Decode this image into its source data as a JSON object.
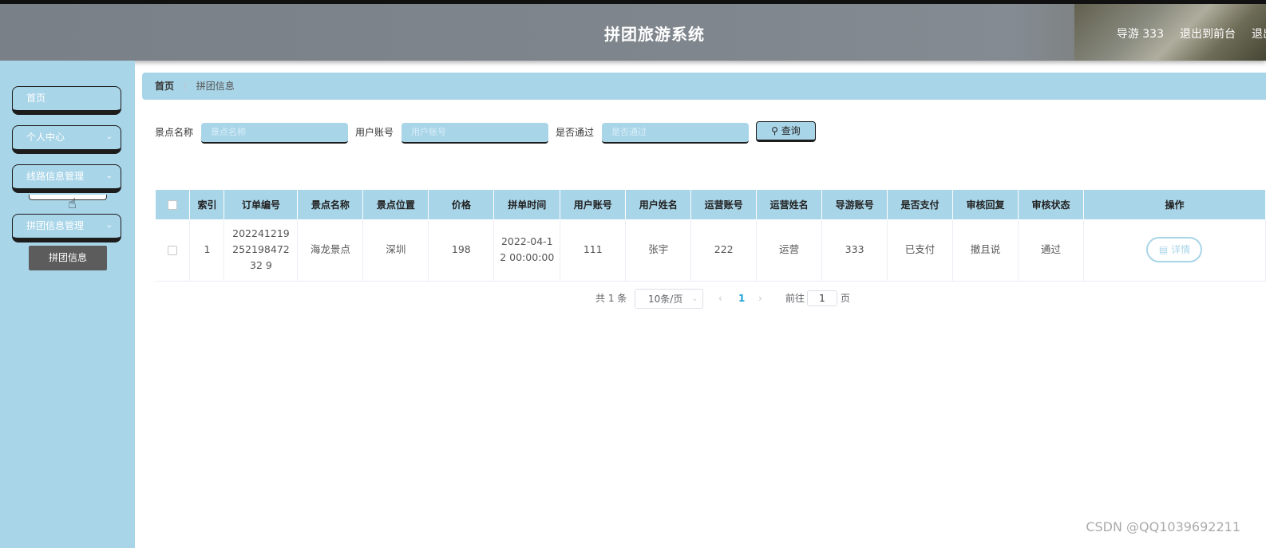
{
  "header": {
    "title": "拼团旅游系统",
    "user": "导游 333",
    "exit_front": "退出到前台",
    "logout": "退出"
  },
  "sidebar": {
    "items": [
      {
        "label": "首页"
      },
      {
        "label": "个人中心"
      },
      {
        "label": "线路信息管理"
      },
      {
        "label": "拼团信息管理"
      }
    ],
    "sub_item": "拼团信息"
  },
  "breadcrumb": {
    "home": "首页",
    "separator": "/",
    "current": "拼团信息"
  },
  "search": {
    "fields": [
      {
        "label": "景点名称",
        "placeholder": "景点名称"
      },
      {
        "label": "用户账号",
        "placeholder": "用户账号"
      },
      {
        "label": "是否通过",
        "placeholder": "是否通过"
      }
    ],
    "query_label": "查询"
  },
  "table": {
    "columns": [
      "索引",
      "订单编号",
      "景点名称",
      "景点位置",
      "价格",
      "拼单时间",
      "用户账号",
      "用户姓名",
      "运营账号",
      "运营姓名",
      "导游账号",
      "是否支付",
      "审核回复",
      "审核状态",
      "操作"
    ],
    "rows": [
      {
        "index": "1",
        "order_no": "20224121925219847232 9",
        "spot_name": "海龙景点",
        "location": "深圳",
        "price": "198",
        "time": "2022-04-12 00:00:00",
        "user_account": "111",
        "user_name": "张宇",
        "ops_account": "222",
        "ops_name": "运营",
        "guide_account": "333",
        "paid": "已支付",
        "reply": "撤且说",
        "status": "通过",
        "action": "详情"
      }
    ]
  },
  "pager": {
    "total": "共 1 条",
    "page_size": "10条/页",
    "current": "1",
    "goto_prefix": "前往",
    "goto_value": "1",
    "goto_suffix": "页"
  },
  "watermark": "CSDN @QQ1039692211"
}
